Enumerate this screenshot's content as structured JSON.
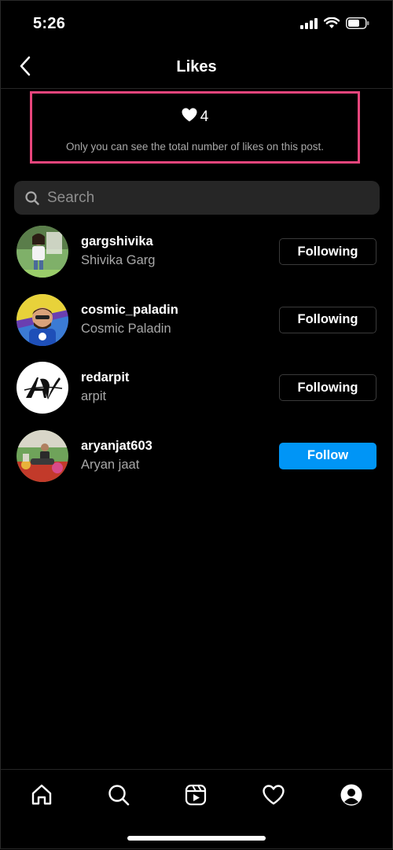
{
  "status_bar": {
    "time": "5:26"
  },
  "header": {
    "title": "Likes"
  },
  "likes_summary": {
    "count": "4",
    "note": "Only you can see the total number of likes on this post."
  },
  "search": {
    "placeholder": "Search",
    "value": ""
  },
  "users": [
    {
      "username": "gargshivika",
      "full_name": "Shivika Garg",
      "button_label": "Following",
      "button_state": "following"
    },
    {
      "username": "cosmic_paladin",
      "full_name": "Cosmic Paladin",
      "button_label": "Following",
      "button_state": "following"
    },
    {
      "username": "redarpit",
      "full_name": "arpit",
      "button_label": "Following",
      "button_state": "following"
    },
    {
      "username": "aryanjat603",
      "full_name": "Aryan jaat",
      "button_label": "Follow",
      "button_state": "follow"
    }
  ],
  "bottom_nav": [
    "home-icon",
    "search-icon",
    "reels-icon",
    "heart-icon",
    "profile-icon"
  ],
  "colors": {
    "background": "#000000",
    "highlight_border": "#e8457c",
    "follow_button": "#0095f6",
    "secondary_text": "#a8a8a8"
  }
}
